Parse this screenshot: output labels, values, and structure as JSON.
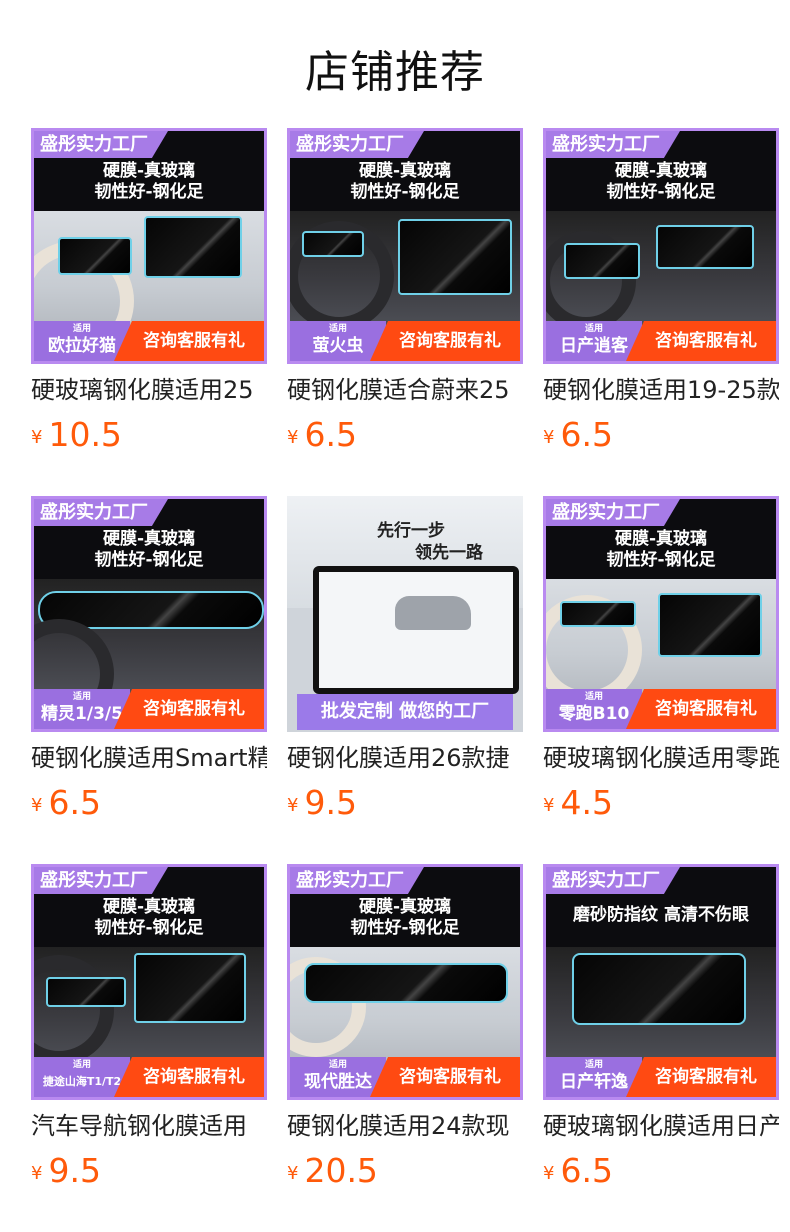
{
  "page": {
    "title": "店铺推荐"
  },
  "common": {
    "brand": "盛彤实力工厂",
    "tagline1": "硬膜-真玻璃",
    "tagline2": "韧性好-钢化足",
    "suited": "适用",
    "cta": "咨询客服有礼",
    "currency": "¥"
  },
  "products": [
    {
      "title": "硬玻璃钢化膜适用25",
      "price": "10.5",
      "model": "欧拉好猫"
    },
    {
      "title": "硬钢化膜适合蔚来25",
      "price": "6.5",
      "model": "萤火虫"
    },
    {
      "title": "硬钢化膜适用19-25款",
      "price": "6.5",
      "model": "日产逍客"
    },
    {
      "title": "硬钢化膜适用Smart精",
      "price": "6.5",
      "model": "精灵1/3/5"
    },
    {
      "title": "硬钢化膜适用26款捷",
      "price": "9.5",
      "slogan1": "先行一步",
      "slogan2": "领先一路",
      "bar": "批发定制 做您的工厂"
    },
    {
      "title": "硬玻璃钢化膜适用零跑",
      "price": "4.5",
      "model": "零跑B10"
    },
    {
      "title": "汽车导航钢化膜适用",
      "price": "9.5",
      "model": "捷途山海T1/T2"
    },
    {
      "title": "硬钢化膜适用24款现",
      "price": "20.5",
      "model": "现代胜达"
    },
    {
      "title": "硬玻璃钢化膜适用日产",
      "price": "6.5",
      "model": "日产轩逸",
      "tagline_alt": "磨砂防指纹 高清不伤眼"
    }
  ]
}
